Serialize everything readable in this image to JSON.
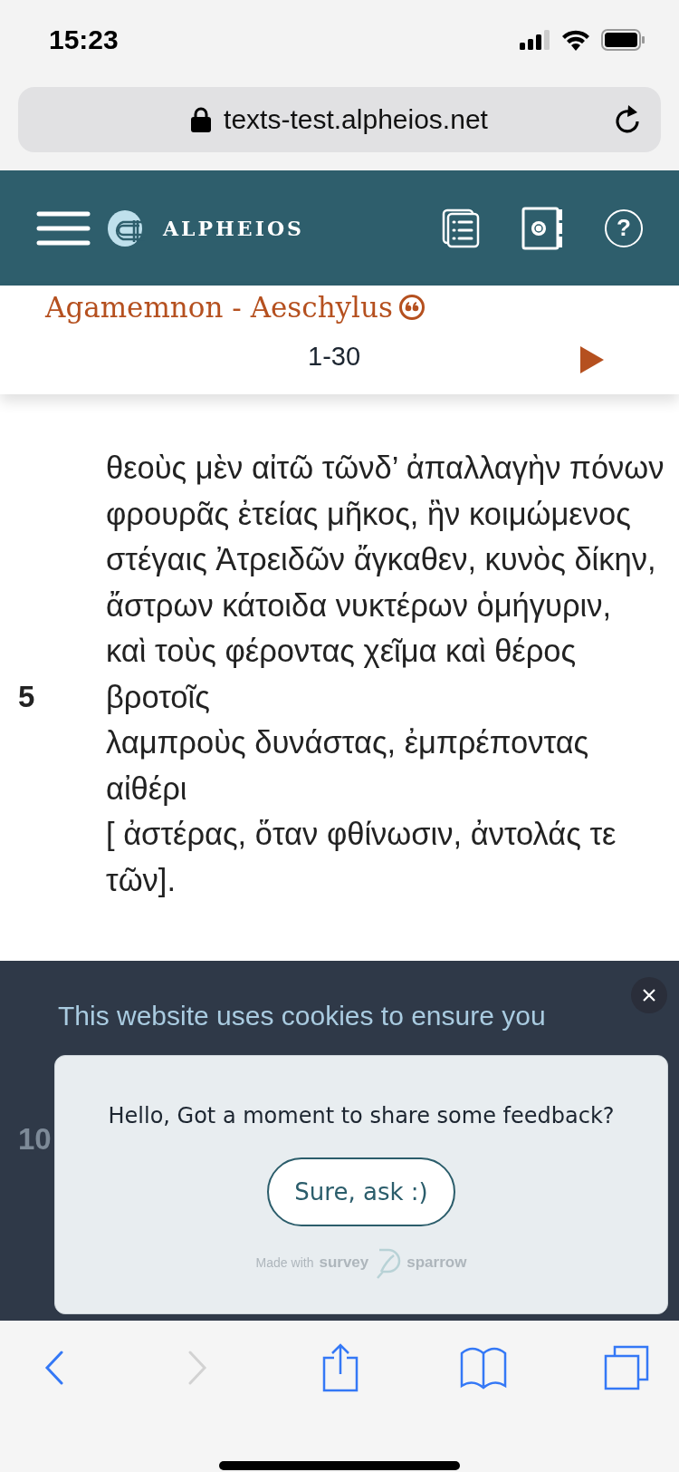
{
  "status_bar": {
    "time": "15:23"
  },
  "address_bar": {
    "url": "texts-test.alpheios.net"
  },
  "header": {
    "logo_text": "ALPHEIOS",
    "help_symbol": "?"
  },
  "document": {
    "title": "Agamemnon - Aeschylus",
    "range": "1-30"
  },
  "verses": [
    {
      "text": "θεοὺς μὲν αἰτῶ τῶνδ’ ἀπαλλαγὴν πόνων"
    },
    {
      "text": "φρουρᾶς ἐτείας μῆκος, ἣν κοιμώμενος"
    },
    {
      "text": "στέγαις Ἀτρειδῶν ἄγκαθεν, κυνὸς δίκην,"
    },
    {
      "text": "ἄστρων κάτοιδα νυκτέρων ὁμήγυριν,"
    },
    {
      "number": "5",
      "text": "καὶ τοὺς φέροντας χεῖμα καὶ θέρος βροτοῖς"
    },
    {
      "text": "λαμπροὺς δυνάστας, ἐμπρέποντας αἰθέρι"
    },
    {
      "text": "[ ἀστέρας, ὅταν φθίνωσιν, ἀντολάς τε τῶν]."
    },
    {
      "number": "10"
    }
  ],
  "cookie_banner": {
    "text": "This website uses cookies to ensure you"
  },
  "survey": {
    "question": "Hello, Got a moment to share some feedback?",
    "button": "Sure, ask :)",
    "credit": "Made with",
    "brand_parts": [
      "survey",
      "sparrow"
    ]
  },
  "toolbar": {
    "buttons": [
      {
        "kind": "back",
        "disabled": false
      },
      {
        "kind": "forward",
        "disabled": true
      },
      {
        "kind": "share",
        "disabled": false
      },
      {
        "kind": "bookmarks",
        "disabled": false
      },
      {
        "kind": "tabs",
        "disabled": false
      }
    ]
  }
}
